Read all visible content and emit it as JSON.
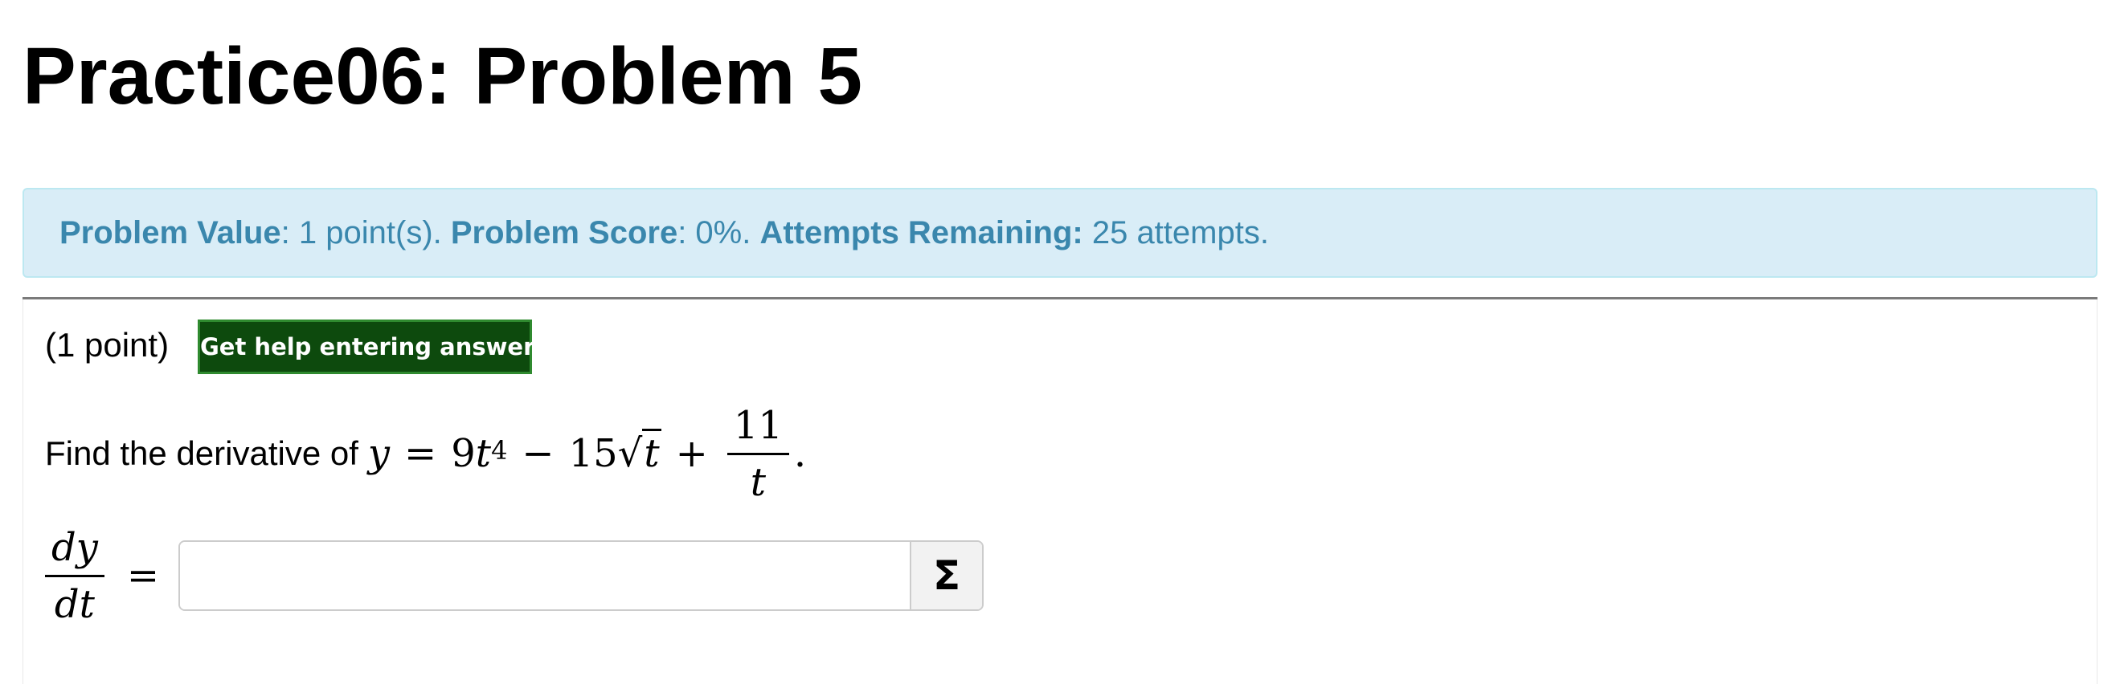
{
  "page": {
    "title": "Practice06: Problem 5"
  },
  "info": {
    "value_label": "Problem Value",
    "value_text": ": 1 point(s). ",
    "score_label": "Problem Score",
    "score_text": ": 0%. ",
    "attempts_label": "Attempts Remaining:",
    "attempts_text": " 25 attempts."
  },
  "problem": {
    "points": "(1 point)",
    "help_button": "Get help entering answers",
    "question_text": "Find the derivative of",
    "equation": {
      "lhs": "y",
      "eq": "=",
      "term1_coef": "9",
      "term1_var": "t",
      "term1_exp": "4",
      "minus": "−",
      "term2_coef": "15",
      "radical": "√",
      "radicand": "t",
      "plus": "+",
      "frac_num": "11",
      "frac_den": "t",
      "period": "."
    },
    "answer": {
      "lhs_num": "dy",
      "lhs_den": "dt",
      "eq": "=",
      "value": "",
      "placeholder": "",
      "equation_editor_icon": "sigma-icon",
      "equation_editor_label": "Σ"
    }
  },
  "colors": {
    "info_bg": "#d9edf7",
    "info_text": "#3a87ad",
    "help_button_bg": "#0d4a0d",
    "help_button_border": "#2f8a2f"
  }
}
